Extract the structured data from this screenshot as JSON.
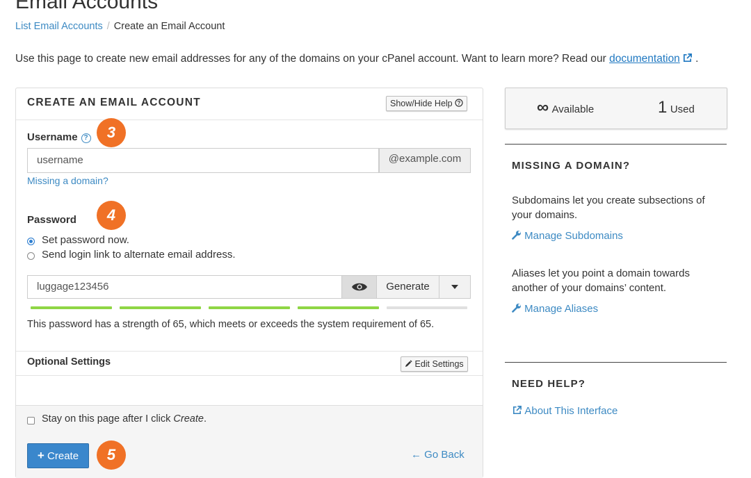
{
  "page": {
    "title": "Email Accounts",
    "breadcrumb": [
      "List Email Accounts",
      "Create an Email Account"
    ],
    "intro_text": "Use this page to create new email addresses for any of the domains on your cPanel account. Want to learn more? Read our",
    "intro_link": "documentation",
    "intro_end": "."
  },
  "form": {
    "title": "CREATE AN EMAIL ACCOUNT",
    "show_hide_help": "Show/Hide Help",
    "username_label": "Username",
    "username_value": "username",
    "domain_suffix": "@example.com",
    "missing_domain_link": "Missing a domain?",
    "password_label": "Password",
    "radio_set_now": "Set password now.",
    "radio_send_link": "Send login link to alternate email address.",
    "password_value": "luggage123456",
    "generate_label": "Generate",
    "strength": 65,
    "strength_segments_filled": 4,
    "strength_segments_total": 5,
    "strength_text": "This password has a strength of 65, which meets or exceeds the system requirement of 65.",
    "optional_settings_label": "Optional Settings",
    "edit_settings_label": "Edit Settings",
    "stay_on_page_prefix": "Stay on this page after I click ",
    "stay_on_page_em": "Create",
    "stay_on_page_suffix": ".",
    "create_label": "Create",
    "go_back_label": "Go Back"
  },
  "badges": [
    "3",
    "4",
    "5"
  ],
  "sidebar": {
    "available_symbol": "∞",
    "available_label": "Available",
    "used_count": "1",
    "used_label": "Used",
    "missing_domain_heading": "MISSING A DOMAIN?",
    "subdomains_text": "Subdomains let you create subsections of your domains.",
    "manage_subdomains": "Manage Subdomains",
    "aliases_text": "Aliases let you point a domain towards another of your domains’ content.",
    "manage_aliases": "Manage Aliases",
    "need_help_heading": "NEED HELP?",
    "about_interface": "About This Interface"
  },
  "colors": {
    "link": "#3d8ac3",
    "badge": "#f07126",
    "strength_good": "#8fd645",
    "strength_empty": "#e0e0e0",
    "primary_button": "#3a87cc"
  }
}
